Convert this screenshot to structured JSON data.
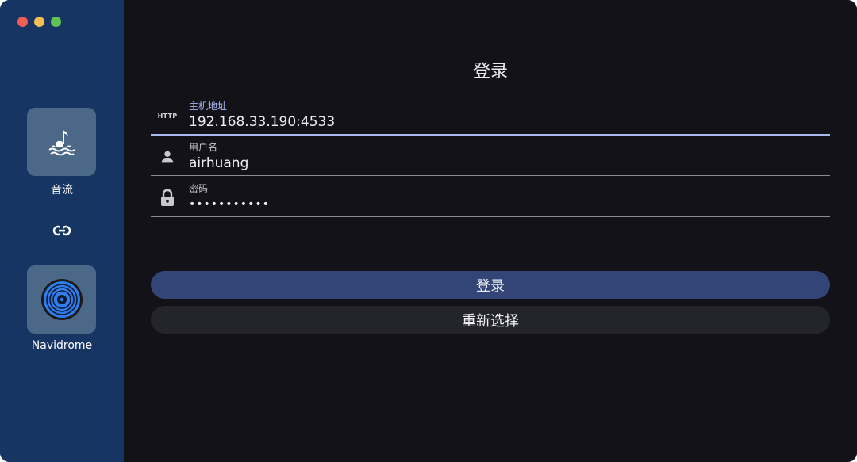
{
  "window": {
    "traffic_lights": {
      "close": "#ee5f57",
      "minimize": "#f4bd4f",
      "zoom": "#5fc454"
    }
  },
  "sidebar": {
    "background": "#163562",
    "items": [
      {
        "label": "音流",
        "icon": "music-note-waves-icon"
      },
      {
        "label": "Navidrome",
        "icon": "vinyl-disc-icon"
      }
    ],
    "link_icon": "link-icon"
  },
  "login": {
    "title": "登录",
    "fields": {
      "host": {
        "label": "主机地址",
        "icon_text": "HTTP",
        "value": "192.168.33.190:4533"
      },
      "username": {
        "label": "用户名",
        "icon": "person-icon",
        "value": "airhuang"
      },
      "password": {
        "label": "密码",
        "icon": "lock-icon",
        "value": "•••••••••••"
      }
    },
    "login_button": "登录",
    "reselect_button": "重新选择"
  },
  "colors": {
    "accent": "#aab8f0",
    "primary_button": "#334577",
    "secondary_button": "#24252b",
    "main_background": "#121218"
  }
}
